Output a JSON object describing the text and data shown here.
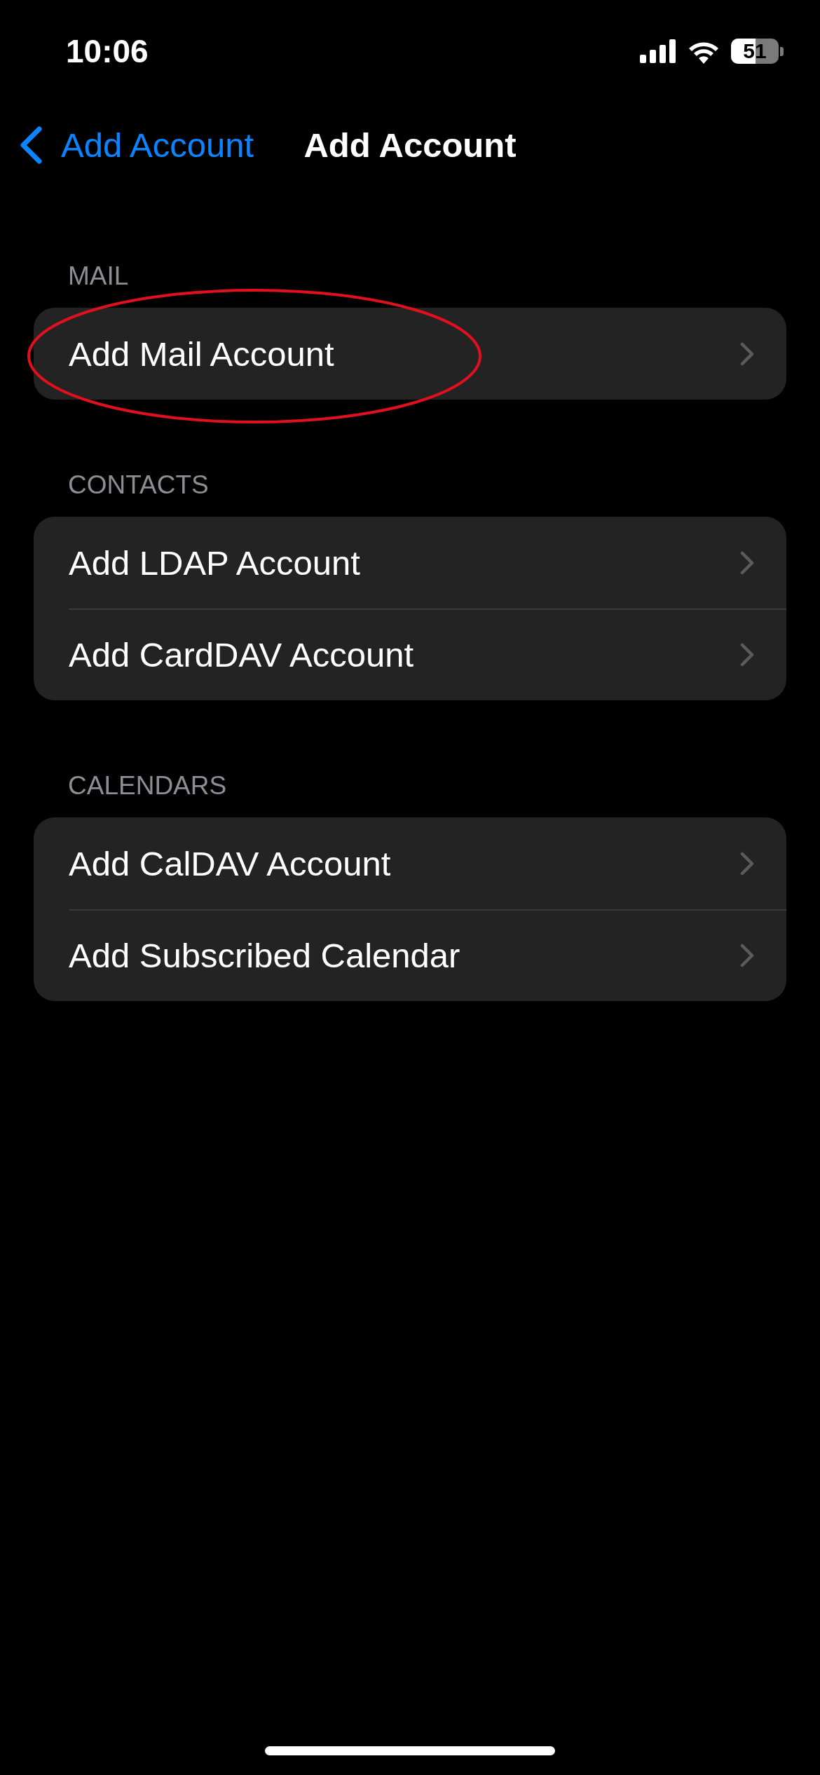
{
  "status_bar": {
    "time": "10:06",
    "battery": "51"
  },
  "nav": {
    "back": "Add Account",
    "title": "Add Account"
  },
  "sections": [
    {
      "header": "MAIL",
      "items": [
        {
          "label": "Add Mail Account",
          "circled": true
        }
      ]
    },
    {
      "header": "CONTACTS",
      "items": [
        {
          "label": "Add LDAP Account",
          "circled": false
        },
        {
          "label": "Add CardDAV Account",
          "circled": false
        }
      ]
    },
    {
      "header": "CALENDARS",
      "items": [
        {
          "label": "Add CalDAV Account",
          "circled": false
        },
        {
          "label": "Add Subscribed Calendar",
          "circled": false
        }
      ]
    }
  ]
}
